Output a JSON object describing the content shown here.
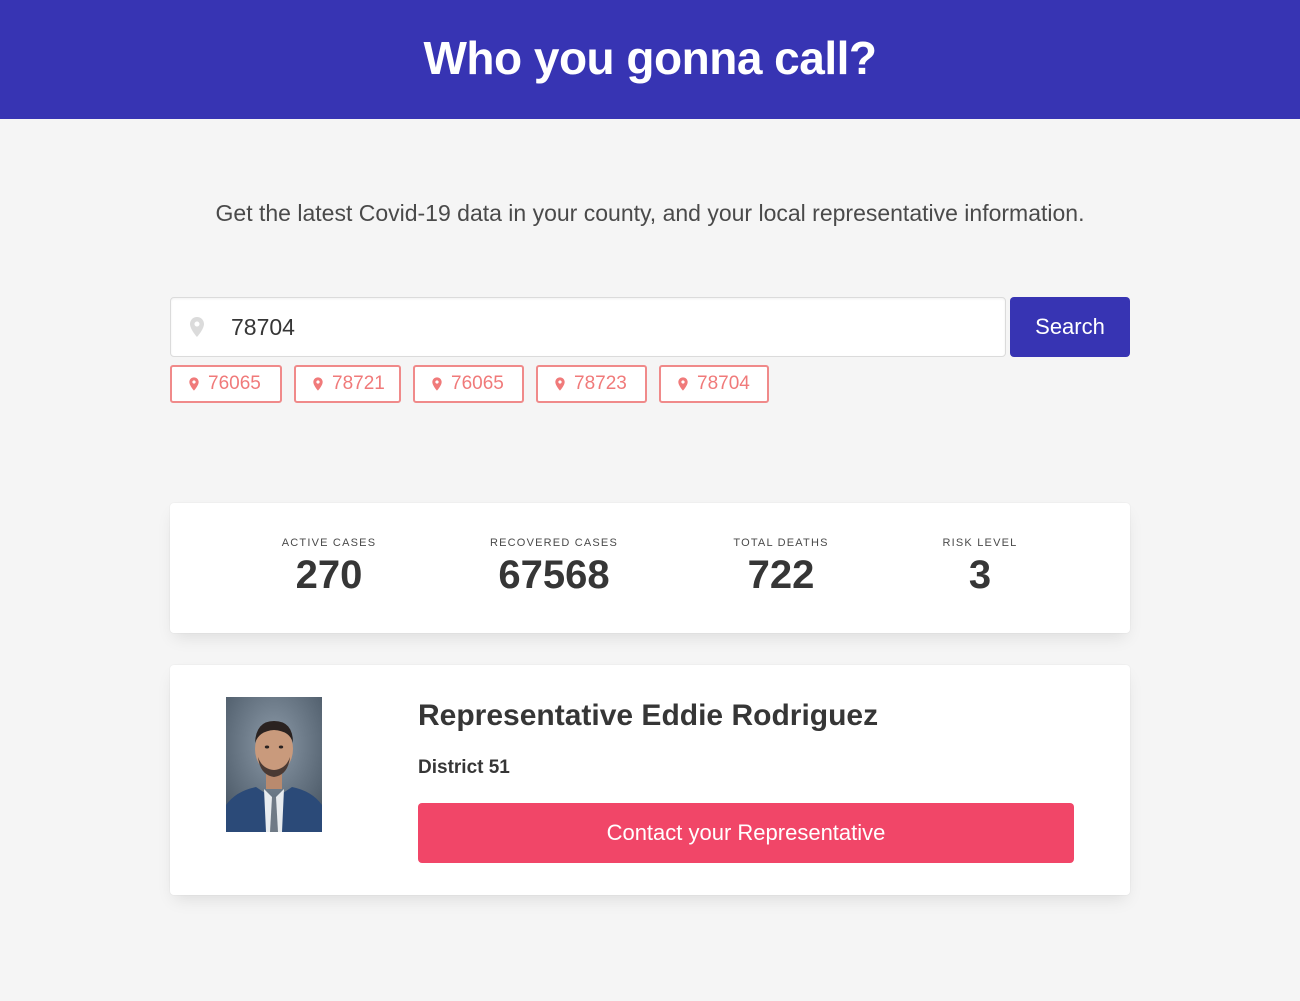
{
  "header": {
    "title": "Who you gonna call?"
  },
  "intro": {
    "text": "Get the latest Covid-19 data in your county, and your local representative information."
  },
  "search": {
    "value": "78704",
    "button_label": "Search",
    "icon": "map-marker-icon"
  },
  "recent_zips": [
    "76065",
    "78721",
    "76065",
    "78723",
    "78704"
  ],
  "stats": [
    {
      "heading": "Active Cases",
      "value": "270"
    },
    {
      "heading": "Recovered Cases",
      "value": "67568"
    },
    {
      "heading": "Total Deaths",
      "value": "722"
    },
    {
      "heading": "Risk Level",
      "value": "3"
    }
  ],
  "representative": {
    "name": "Representative Eddie Rodriguez",
    "district": "District 51",
    "contact_label": "Contact your Representative"
  },
  "colors": {
    "primary": "#3734b3",
    "danger": "#f14668",
    "tag_border": "#f08a8a",
    "background": "#f5f5f5"
  }
}
